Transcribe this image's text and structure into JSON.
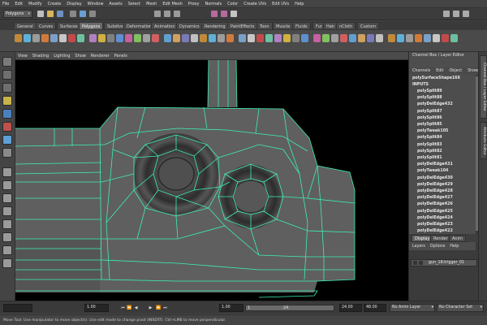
{
  "menubar": {
    "items": [
      "File",
      "Edit",
      "Modify",
      "Create",
      "Display",
      "Window",
      "Assets",
      "Select",
      "Mesh",
      "Edit Mesh",
      "Proxy",
      "Normals",
      "Color",
      "Create UVs",
      "Edit UVs",
      "Help"
    ]
  },
  "status_line": {
    "mode": "Polygons"
  },
  "shelf_tabs": {
    "items": [
      "General",
      "Curves",
      "Surfaces",
      "Polygons",
      "Subdivs",
      "Deformation",
      "Animation",
      "Dynamics",
      "Rendering",
      "PaintEffects",
      "Toon",
      "Muscle",
      "Fluids",
      "Fur",
      "Hair",
      "nCloth",
      "Custom"
    ],
    "active": "Polygons"
  },
  "viewport_menu": {
    "items": [
      "View",
      "Shading",
      "Lighting",
      "Show",
      "Renderer",
      "Panels"
    ]
  },
  "channel_box": {
    "title": "Channel Box / Layer Editor",
    "menu": [
      "Channels",
      "Edit",
      "Object",
      "Show"
    ],
    "object": "polySurfaceShape166",
    "inputs_label": "INPUTS",
    "history": [
      "polySplit89",
      "polySplit88",
      "polyDelEdge432",
      "polySplit87",
      "polySplit86",
      "polySplit85",
      "polyTweak105",
      "polySplit84",
      "polySplit83",
      "polySplit82",
      "polySplit81",
      "polyDelEdge431",
      "polyTweak104",
      "polyDelEdge430",
      "polyDelEdge429",
      "polyDelEdge428",
      "polyDelEdge427",
      "polyDelEdge426",
      "polyDelEdge425",
      "polyDelEdge424",
      "polyDelEdge423",
      "polyDelEdge422"
    ]
  },
  "side_tabs": {
    "channel_box": "Channel Box / Layer Editor",
    "attribute_editor": "Attribute Editor"
  },
  "layer_editor": {
    "tabs": [
      "Display",
      "Render",
      "Anim"
    ],
    "active_tab": "Display",
    "menu": [
      "Layers",
      "Options",
      "Help"
    ],
    "layer_name": "gun_18:trigger_01"
  },
  "time_slider": {
    "start": "1.00",
    "current": "1.00",
    "range_start": "1",
    "range_end": "24",
    "end": "24.00",
    "playback_end": "48.00",
    "anim_layer": "No Anim Layer",
    "character_set": "No Character Set"
  },
  "help_line": {
    "text": "Move Tool: Use manipulator to move object(s). Use edit mode to change pivot (INSERT). Ctrl+LMB to move perpendicular."
  },
  "colors": {
    "wireframe": "#3df0b0",
    "viewport_bg": "#000000",
    "ui_bg": "#444444"
  }
}
